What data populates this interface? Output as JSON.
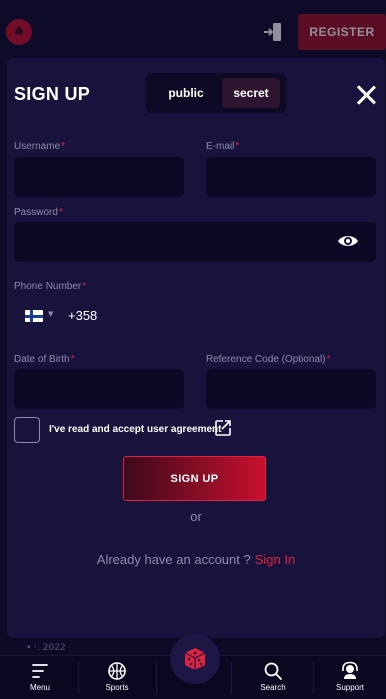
{
  "header": {
    "logo_icon": "spade-icon",
    "login_icon": "login-door-icon",
    "register_label": "REGISTER"
  },
  "background": {
    "peek_text": "• ·. 2022"
  },
  "modal": {
    "title": "SIGN UP",
    "toggle": {
      "options": [
        "public",
        "secret"
      ],
      "selected": "secret"
    },
    "fields": {
      "username_label": "Username",
      "email_label": "E-mail",
      "password_label": "Password",
      "phone_label": "Phone Number",
      "dob_label": "Date of Birth",
      "reference_label": "Reference Code (Optional)",
      "required_mark": "*",
      "username_value": "",
      "email_value": "",
      "password_value": "",
      "dob_value": "",
      "reference_value": ""
    },
    "phone": {
      "country_flag": "finland-flag",
      "dial_code": "+358"
    },
    "agreement_text": "I've read and accept user agreement",
    "submit_label": "SIGN UP",
    "or_text": "or",
    "account_prompt": "Already have an account ?",
    "sign_in_label": "Sign In"
  },
  "bottom_nav": {
    "items": [
      {
        "label": "Menu",
        "icon": "menu-lines-icon"
      },
      {
        "label": "Sports",
        "icon": "basketball-icon"
      },
      {
        "label": "Search",
        "icon": "search-icon"
      },
      {
        "label": "Support",
        "icon": "headset-icon"
      }
    ],
    "center_icon": "dice-icon"
  },
  "colors": {
    "accent": "#e0243f",
    "modal_bg": "#17133d",
    "field_bg": "#0b0924",
    "label": "#8f8cab"
  }
}
